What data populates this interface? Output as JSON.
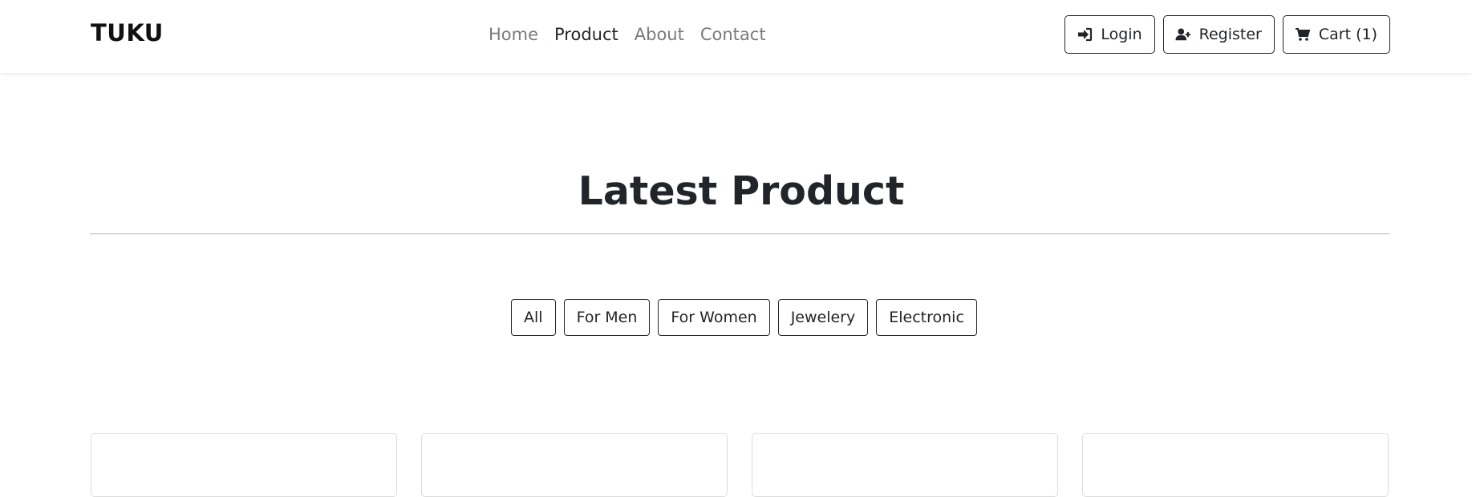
{
  "navbar": {
    "brand": "TUKU",
    "links": [
      {
        "label": "Home",
        "active": false
      },
      {
        "label": "Product",
        "active": true
      },
      {
        "label": "About",
        "active": false
      },
      {
        "label": "Contact",
        "active": false
      }
    ],
    "buttons": {
      "login": {
        "label": "Login",
        "icon": "sign-in-icon"
      },
      "register": {
        "label": "Register",
        "icon": "user-plus-icon"
      },
      "cart": {
        "label": "Cart (1)",
        "icon": "cart-icon"
      }
    }
  },
  "main": {
    "title": "Latest Product",
    "filters": [
      "All",
      "For Men",
      "For Women",
      "Jewelery",
      "Electronic"
    ]
  },
  "colors": {
    "text": "#212529",
    "muted": "#7a7a7a",
    "border": "#212529"
  }
}
